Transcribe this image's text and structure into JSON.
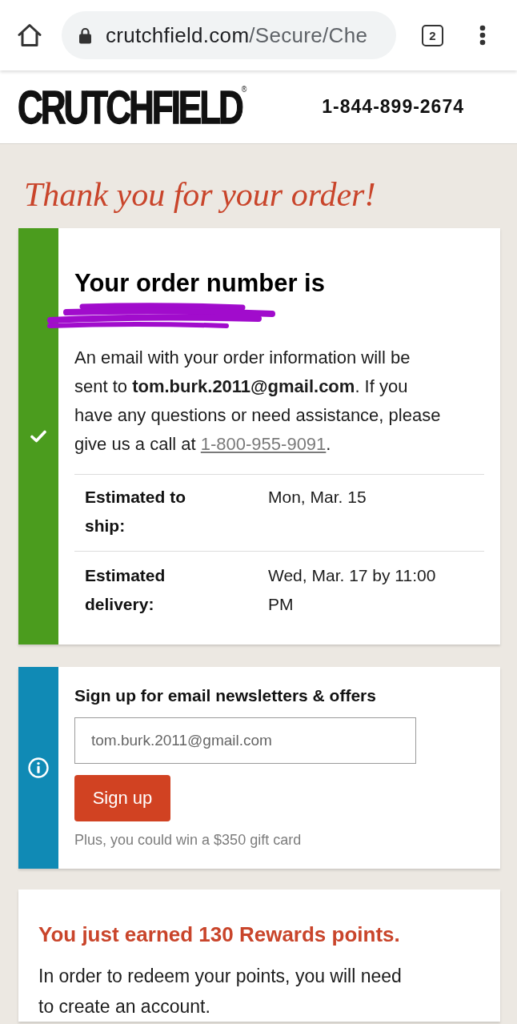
{
  "browser": {
    "url_host": "crutchfield.com",
    "url_path": "/Secure/Che",
    "tab_count": "2"
  },
  "header": {
    "logo": "CRUTCHFIELD$^{®}$",
    "phone": "1-844-899-2674"
  },
  "page_title": "Thank you for your order!",
  "order_card": {
    "heading": "Your order number is",
    "message": "An email with your order information will be sent to **tom.burk.2011@gmail.com**. If you have any questions or need assistance, please give us a call at",
    "phone_link": "1-800-955-9091",
    "message_end": ".",
    "estimates": [
      {
        "label": "Estimated to ship:",
        "value": "Mon, Mar. 15"
      },
      {
        "label": "Estimated delivery:",
        "value": "Wed, Mar. 17 by 11:00 PM"
      }
    ]
  },
  "signup_card": {
    "heading": "Sign up for email newsletters & offers",
    "email_value": "tom.burk.2011@gmail.com",
    "button": "Sign up",
    "note": "Plus, you could win a $350 gift card"
  },
  "rewards_card": {
    "heading": "You just earned 130 Rewards points.",
    "message": "In order to redeem your points, you will need to create an account."
  }
}
